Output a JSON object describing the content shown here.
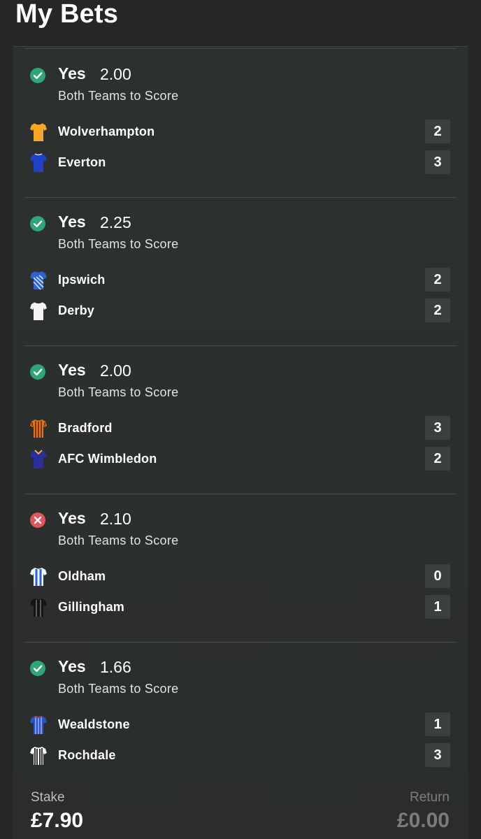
{
  "header": {
    "title": "My Bets"
  },
  "colors": {
    "win": "#2fa57a",
    "loss": "#e2555a",
    "background": "#262626",
    "card": "#2c302f"
  },
  "legs": [
    {
      "status": "won",
      "status_icon": "check-circle-icon",
      "selection": "Yes",
      "odds": "2.00",
      "market": "Both Teams to Score",
      "home": {
        "name": "Wolverhampton",
        "score": "2",
        "kit": "wolverhampton-kit-icon"
      },
      "away": {
        "name": "Everton",
        "score": "3",
        "kit": "everton-kit-icon"
      }
    },
    {
      "status": "won",
      "status_icon": "check-circle-icon",
      "selection": "Yes",
      "odds": "2.25",
      "market": "Both Teams to Score",
      "home": {
        "name": "Ipswich",
        "score": "2",
        "kit": "ipswich-kit-icon"
      },
      "away": {
        "name": "Derby",
        "score": "2",
        "kit": "derby-kit-icon"
      }
    },
    {
      "status": "won",
      "status_icon": "check-circle-icon",
      "selection": "Yes",
      "odds": "2.00",
      "market": "Both Teams to Score",
      "home": {
        "name": "Bradford",
        "score": "3",
        "kit": "bradford-kit-icon"
      },
      "away": {
        "name": "AFC Wimbledon",
        "score": "2",
        "kit": "afc-wimbledon-kit-icon"
      }
    },
    {
      "status": "lost",
      "status_icon": "cross-circle-icon",
      "selection": "Yes",
      "odds": "2.10",
      "market": "Both Teams to Score",
      "home": {
        "name": "Oldham",
        "score": "0",
        "kit": "oldham-kit-icon"
      },
      "away": {
        "name": "Gillingham",
        "score": "1",
        "kit": "gillingham-kit-icon"
      }
    },
    {
      "status": "won",
      "status_icon": "check-circle-icon",
      "selection": "Yes",
      "odds": "1.66",
      "market": "Both Teams to Score",
      "home": {
        "name": "Wealdstone",
        "score": "1",
        "kit": "wealdstone-kit-icon"
      },
      "away": {
        "name": "Rochdale",
        "score": "3",
        "kit": "rochdale-kit-icon"
      }
    }
  ],
  "footer": {
    "stake_label": "Stake",
    "stake_value": "£7.90",
    "return_label": "Return",
    "return_value": "£0.00"
  }
}
